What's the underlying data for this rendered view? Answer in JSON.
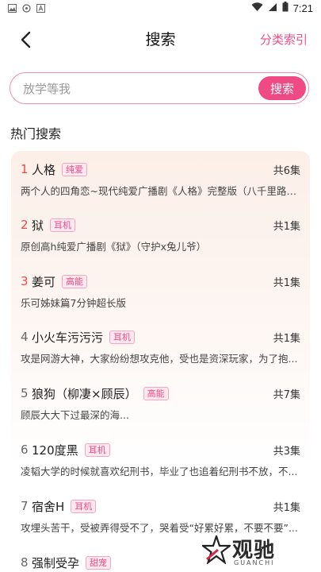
{
  "status_bar": {
    "time": "7:21"
  },
  "header": {
    "title": "搜索",
    "category_link": "分类索引"
  },
  "search": {
    "placeholder": "放学等我",
    "button": "搜索"
  },
  "hot": {
    "title": "热门搜索",
    "items": [
      {
        "rank": "1",
        "title": "人格",
        "tag": "纯爱",
        "count": "共6集",
        "desc": "两个人的四角恋~现代纯爱广播剧《人格》完整版（八千里路云..."
      },
      {
        "rank": "2",
        "title": "狱",
        "tag": "耳机",
        "count": "共1集",
        "desc": "原创高h纯爱广播剧《狱》（守护x兔儿爷）"
      },
      {
        "rank": "3",
        "title": "姜可",
        "tag": "高能",
        "count": "共1集",
        "desc": "乐可姊妹篇7分钟超长版"
      },
      {
        "rank": "4",
        "title": "小火车污污污",
        "tag": "耳机",
        "count": "共1集",
        "desc": "攻是网游大神，大家纷纷想攻克他，受也是资深玩家，为了抱..."
      },
      {
        "rank": "5",
        "title": "狼狗（柳凄×顾辰）",
        "tag": "高能",
        "count": "共7集",
        "desc": "顾辰大大下过最深的海..."
      },
      {
        "rank": "6",
        "title": "120度黑",
        "tag": "耳机",
        "count": "共3集",
        "desc": "凌韬大学的时候就喜欢纪刑书，毕业了也追着纪刑书不放，不..."
      },
      {
        "rank": "7",
        "title": "宿舍H",
        "tag": "耳机",
        "count": "共1集",
        "desc": "攻埋头苦干，受被弄得受不了，哭着受“好累好累，不要不要”..."
      },
      {
        "rank": "8",
        "title": "强制受孕",
        "tag": "甜宠",
        "count": "",
        "desc": ""
      }
    ]
  },
  "watermark": {
    "text": "观驰",
    "sub": "GUANCHI"
  },
  "colors": {
    "accent": "#ee4a84",
    "rank_top": "#ec4a4a"
  }
}
